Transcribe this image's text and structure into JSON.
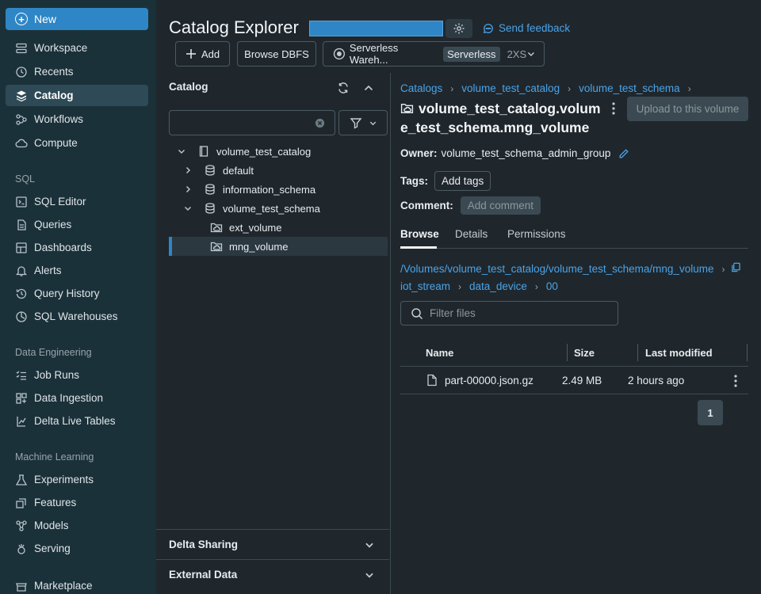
{
  "sidebar": {
    "new_label": "New",
    "top_items": [
      {
        "label": "Workspace",
        "icon": "workspace-icon"
      },
      {
        "label": "Recents",
        "icon": "clock-icon"
      },
      {
        "label": "Catalog",
        "icon": "catalog-icon",
        "active": true
      },
      {
        "label": "Workflows",
        "icon": "workflows-icon"
      },
      {
        "label": "Compute",
        "icon": "cloud-icon"
      }
    ],
    "sql_section": "SQL",
    "sql_items": [
      {
        "label": "SQL Editor",
        "icon": "sql-editor-icon"
      },
      {
        "label": "Queries",
        "icon": "queries-icon"
      },
      {
        "label": "Dashboards",
        "icon": "dashboards-icon"
      },
      {
        "label": "Alerts",
        "icon": "bell-icon"
      },
      {
        "label": "Query History",
        "icon": "history-icon"
      },
      {
        "label": "SQL Warehouses",
        "icon": "warehouse-icon"
      }
    ],
    "de_section": "Data Engineering",
    "de_items": [
      {
        "label": "Job Runs",
        "icon": "job-runs-icon"
      },
      {
        "label": "Data Ingestion",
        "icon": "ingestion-icon"
      },
      {
        "label": "Delta Live Tables",
        "icon": "delta-icon"
      }
    ],
    "ml_section": "Machine Learning",
    "ml_items": [
      {
        "label": "Experiments",
        "icon": "flask-icon"
      },
      {
        "label": "Features",
        "icon": "features-icon"
      },
      {
        "label": "Models",
        "icon": "models-icon"
      },
      {
        "label": "Serving",
        "icon": "serving-icon"
      }
    ],
    "bottom_item": {
      "label": "Marketplace",
      "icon": "marketplace-icon"
    }
  },
  "header": {
    "title": "Catalog Explorer",
    "feedback_label": "Send feedback",
    "add_label": "Add",
    "browse_dbfs_label": "Browse DBFS",
    "warehouse_name": "Serverless Wareh...",
    "warehouse_badge": "Serverless",
    "warehouse_size": "2XS"
  },
  "catalog_panel": {
    "title": "Catalog",
    "search_value": "",
    "tree": {
      "catalog": "volume_test_catalog",
      "schemas": [
        "default",
        "information_schema",
        "volume_test_schema"
      ],
      "volumes": [
        "ext_volume",
        "mng_volume"
      ]
    },
    "delta_sharing_label": "Delta Sharing",
    "external_data_label": "External Data"
  },
  "detail": {
    "breadcrumbs": [
      "Catalogs",
      "volume_test_catalog",
      "volume_test_schema"
    ],
    "title": "volume_test_catalog.volume_test_schema.mng_volume",
    "upload_label": "Upload to this volume",
    "owner_key": "Owner:",
    "owner_value": "volume_test_schema_admin_group",
    "tags_key": "Tags:",
    "add_tags_label": "Add tags",
    "comment_key": "Comment:",
    "add_comment_label": "Add comment",
    "tabs": [
      "Browse",
      "Details",
      "Permissions"
    ],
    "path": "/Volumes/volume_test_catalog/volume_test_schema/mng_volume",
    "subpath": [
      "iot_stream",
      "data_device",
      "00"
    ],
    "filter_placeholder": "Filter files",
    "columns": [
      "Name",
      "Size",
      "Last modified"
    ],
    "files": [
      {
        "name": "part-00000.json.gz",
        "size": "2.49 MB",
        "modified": "2 hours ago"
      }
    ],
    "page": "1"
  },
  "colors": {
    "accent": "#2f86c6",
    "link": "#4aa3e8",
    "sidebar_bg": "#1b3139",
    "page_bg": "#1f272d"
  }
}
